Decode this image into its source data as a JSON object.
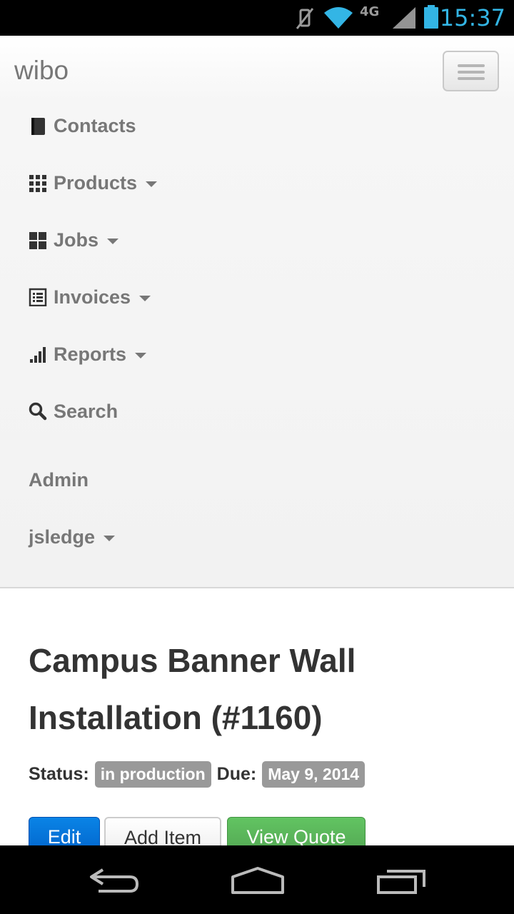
{
  "status_bar": {
    "time": "15:37",
    "network_label": "4G",
    "icons": [
      "vibrate-mute-icon",
      "wifi-icon",
      "lte-icon",
      "signal-icon",
      "battery-icon"
    ],
    "accent": "#33b5e5"
  },
  "navbar": {
    "brand": "wibo",
    "items": [
      {
        "label": "Contacts",
        "icon": "book-icon",
        "dropdown": false
      },
      {
        "label": "Products",
        "icon": "grid-icon",
        "dropdown": true
      },
      {
        "label": "Jobs",
        "icon": "large-grid-icon",
        "dropdown": true
      },
      {
        "label": "Invoices",
        "icon": "list-icon",
        "dropdown": true
      },
      {
        "label": "Reports",
        "icon": "signal-bars-icon",
        "dropdown": true
      },
      {
        "label": "Search",
        "icon": "search-icon",
        "dropdown": false
      }
    ],
    "admin": "Admin",
    "user": "jsledge"
  },
  "job": {
    "title": "Campus Banner Wall Installation (#1160)",
    "status_label": "Status:",
    "status_value": "in production",
    "due_label": "Due:",
    "due_value": "May 9, 2014"
  },
  "actions": {
    "edit": "Edit",
    "add_item": "Add Item",
    "view_quote": "View Quote"
  },
  "colors": {
    "primary": "#0a7ae0",
    "success": "#5bb75b",
    "label_bg": "#999999"
  }
}
